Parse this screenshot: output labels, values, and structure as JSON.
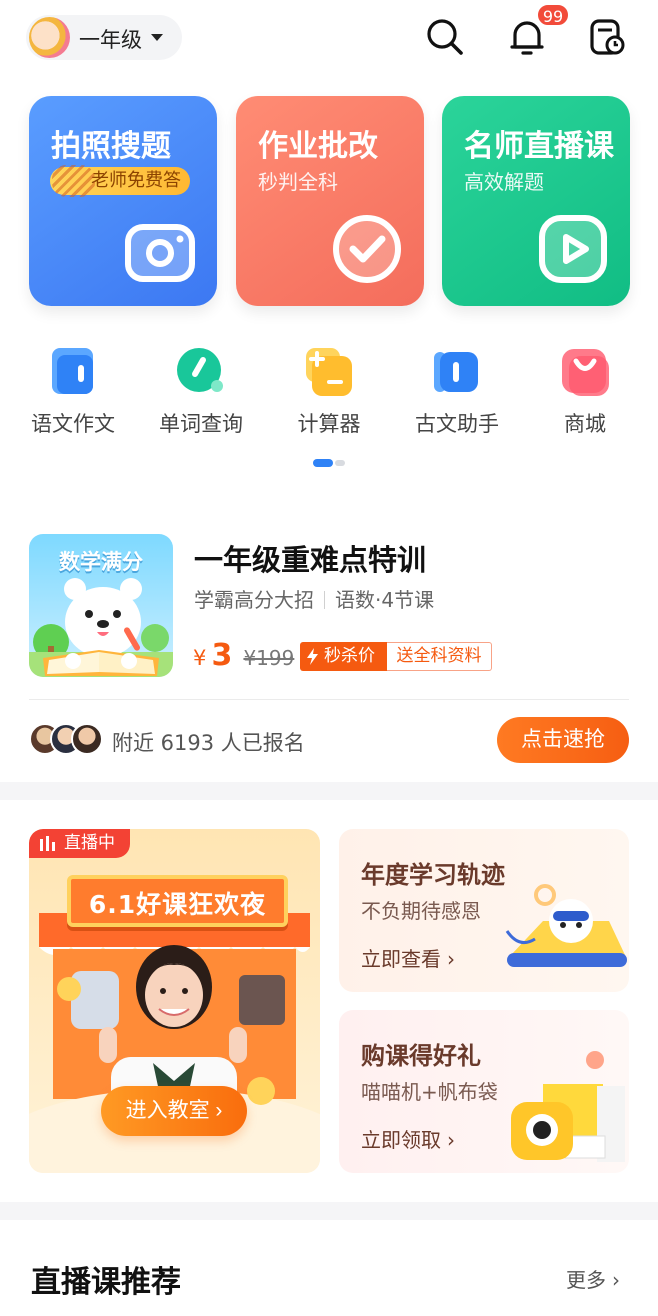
{
  "header": {
    "grade": "一年级",
    "notification_count": "99"
  },
  "entry_cards": [
    {
      "title": "拍照搜题",
      "tag": "老师免费答"
    },
    {
      "title": "作业批改",
      "subtitle": "秒判全科"
    },
    {
      "title": "名师直播课",
      "subtitle": "高效解题"
    }
  ],
  "tools": [
    {
      "label": "语文作文"
    },
    {
      "label": "单词查询"
    },
    {
      "label": "计算器"
    },
    {
      "label": "古文助手"
    },
    {
      "label": "商城"
    }
  ],
  "promo": {
    "cover_title": "数学满分",
    "title": "一年级重难点特训",
    "subtitle_left": "学霸高分大招",
    "subtitle_right": "语数·4节课",
    "currency": "¥",
    "price": "3",
    "original_price": "¥199",
    "flash_tag": "秒杀价",
    "gift_tag": "送全科资料",
    "signup_text": "附近 6193 人已报名",
    "cta": "点击速抢"
  },
  "activity": {
    "live_badge": "直播中",
    "live_banner": "6.1好课狂欢夜",
    "live_cta": "进入教室",
    "cards": [
      {
        "title": "年度学习轨迹",
        "subtitle": "不负期待感恩",
        "link": "立即查看"
      },
      {
        "title": "购课得好礼",
        "subtitle": "喵喵机+帆布袋",
        "link": "立即领取"
      }
    ]
  },
  "recommend": {
    "title": "直播课推荐",
    "more": "更多"
  },
  "colors": {
    "accent_blue": "#3c78f2",
    "accent_orange": "#f65e12",
    "accent_green": "#11bd84",
    "badge_red": "#f24b3a"
  }
}
